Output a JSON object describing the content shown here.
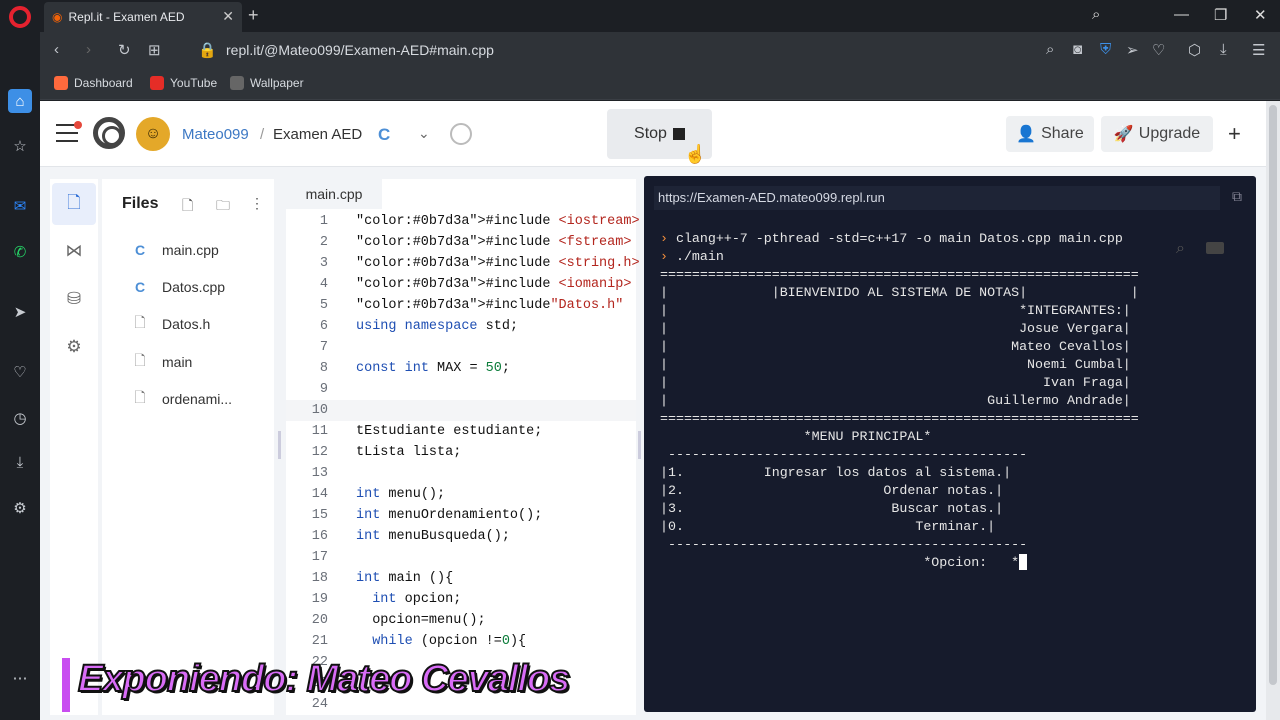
{
  "browser": {
    "tab_title": "Repl.it - Examen AED",
    "url": "repl.it/@Mateo099/Examen-AED#main.cpp",
    "bookmarks": [
      {
        "label": "Dashboard",
        "color": "#ff6a3d"
      },
      {
        "label": "YouTube",
        "color": "#e52d27"
      },
      {
        "label": "Wallpaper",
        "color": "#666666"
      }
    ]
  },
  "header": {
    "user": "Mateo099",
    "separator": "/",
    "project": "Examen AED",
    "stop_label": "Stop",
    "share_label": "Share",
    "upgrade_label": "Upgrade"
  },
  "files": {
    "title": "Files",
    "items": [
      {
        "name": "main.cpp",
        "icon": "cpp-icon"
      },
      {
        "name": "Datos.cpp",
        "icon": "cpp-icon"
      },
      {
        "name": "Datos.h",
        "icon": "file-icon"
      },
      {
        "name": "main",
        "icon": "file-icon"
      },
      {
        "name": "ordenami...",
        "icon": "file-icon"
      }
    ]
  },
  "editor": {
    "tab": "main.cpp",
    "current_line": 10,
    "lines": [
      {
        "n": "1",
        "t": "#include <iostream>"
      },
      {
        "n": "2",
        "t": "#include <fstream>"
      },
      {
        "n": "3",
        "t": "#include <string.h>"
      },
      {
        "n": "4",
        "t": "#include <iomanip>"
      },
      {
        "n": "5",
        "t": "#include\"Datos.h\""
      },
      {
        "n": "6",
        "t": "using namespace std;"
      },
      {
        "n": "7",
        "t": ""
      },
      {
        "n": "8",
        "t": "const int MAX = 50;"
      },
      {
        "n": "9",
        "t": ""
      },
      {
        "n": "10",
        "t": ""
      },
      {
        "n": "11",
        "t": "tEstudiante estudiante;"
      },
      {
        "n": "12",
        "t": "tLista lista;"
      },
      {
        "n": "13",
        "t": ""
      },
      {
        "n": "14",
        "t": "int menu();"
      },
      {
        "n": "15",
        "t": "int menuOrdenamiento();"
      },
      {
        "n": "16",
        "t": "int menuBusqueda();"
      },
      {
        "n": "17",
        "t": ""
      },
      {
        "n": "18",
        "t": "int main (){"
      },
      {
        "n": "19",
        "t": "  int opcion;"
      },
      {
        "n": "20",
        "t": "  opcion=menu();"
      },
      {
        "n": "21",
        "t": "  while (opcion !=0){"
      },
      {
        "n": "22",
        "t": ""
      },
      {
        "n": "23",
        "t": ""
      },
      {
        "n": "24",
        "t": ""
      }
    ]
  },
  "console": {
    "url": "https://Examen-AED.mateo099.repl.run",
    "command1": "clang++-7 -pthread -std=c++17 -o main Datos.cpp main.cpp",
    "command2": "./main",
    "output": [
      "============================================================",
      "|             |BIENVENIDO AL SISTEMA DE NOTAS|             |",
      "|                                            *INTEGRANTES:|",
      "|                                            Josue Vergara|",
      "|                                           Mateo Cevallos|",
      "|                                             Noemi Cumbal|",
      "|                                               Ivan Fraga|",
      "|                                        Guillermo Andrade|",
      "============================================================",
      "                  *MENU PRINCIPAL*",
      " ---------------------------------------------",
      "|1.          Ingresar los datos al sistema.|",
      "|2.                         Ordenar notas.|",
      "|3.                          Buscar notas.|",
      "|0.                             Terminar.|",
      " ---------------------------------------------",
      "                                 *Opcion:   *"
    ]
  },
  "caption": "Exponiendo: Mateo Cevallos"
}
